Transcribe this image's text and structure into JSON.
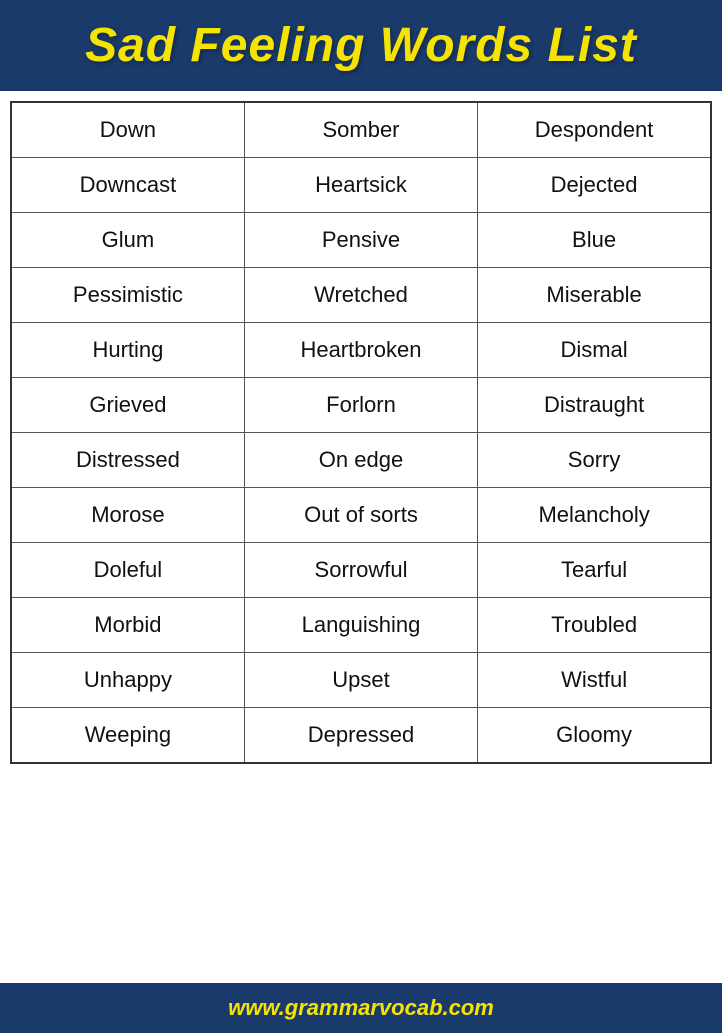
{
  "header": {
    "title": "Sad Feeling Words List"
  },
  "table": {
    "rows": [
      [
        "Down",
        "Somber",
        "Despondent"
      ],
      [
        "Downcast",
        "Heartsick",
        "Dejected"
      ],
      [
        "Glum",
        "Pensive",
        "Blue"
      ],
      [
        "Pessimistic",
        "Wretched",
        "Miserable"
      ],
      [
        "Hurting",
        "Heartbroken",
        "Dismal"
      ],
      [
        "Grieved",
        "Forlorn",
        "Distraught"
      ],
      [
        "Distressed",
        "On edge",
        "Sorry"
      ],
      [
        "Morose",
        "Out of sorts",
        "Melancholy"
      ],
      [
        "Doleful",
        "Sorrowful",
        "Tearful"
      ],
      [
        "Morbid",
        "Languishing",
        "Troubled"
      ],
      [
        "Unhappy",
        "Upset",
        "Wistful"
      ],
      [
        "Weeping",
        "Depressed",
        "Gloomy"
      ]
    ]
  },
  "footer": {
    "url": "www.grammarvocab.com"
  }
}
